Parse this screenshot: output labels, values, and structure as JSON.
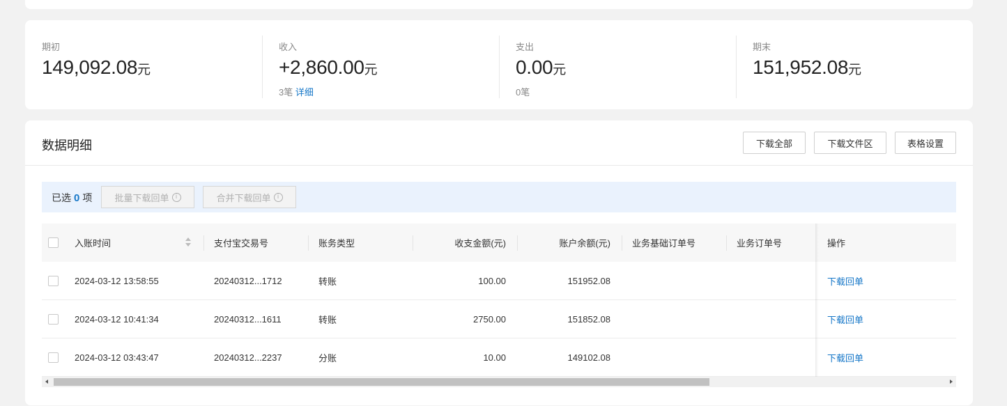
{
  "summary": {
    "items": [
      {
        "label": "期初",
        "amount": "149,092.08",
        "unit": "元"
      },
      {
        "label": "收入",
        "amount": "+2,860.00",
        "unit": "元",
        "count": "3笔",
        "link": "详细"
      },
      {
        "label": "支出",
        "amount": "0.00",
        "unit": "元",
        "count": "0笔"
      },
      {
        "label": "期末",
        "amount": "151,952.08",
        "unit": "元"
      }
    ]
  },
  "detail": {
    "title": "数据明细",
    "buttons": {
      "download_all": "下载全部",
      "download_area": "下载文件区",
      "table_settings": "表格设置"
    },
    "selection": {
      "prefix": "已选",
      "count": "0",
      "suffix": "项",
      "batch_download": "批量下载回单",
      "merge_download": "合并下载回单"
    },
    "columns": [
      "入账时间",
      "支付宝交易号",
      "账务类型",
      "收支金额(元)",
      "账户余额(元)",
      "业务基础订单号",
      "业务订单号",
      "操作"
    ],
    "rows": [
      {
        "time": "2024-03-12 13:58:55",
        "trade_no": "20240312...1712",
        "type": "转账",
        "amount": "100.00",
        "balance": "151952.08",
        "base_order": "",
        "order": "",
        "action": "下载回单"
      },
      {
        "time": "2024-03-12 10:41:34",
        "trade_no": "20240312...1611",
        "type": "转账",
        "amount": "2750.00",
        "balance": "151852.08",
        "base_order": "",
        "order": "",
        "action": "下载回单"
      },
      {
        "time": "2024-03-12 03:43:47",
        "trade_no": "20240312...2237",
        "type": "分账",
        "amount": "10.00",
        "balance": "149102.08",
        "base_order": "",
        "order": "",
        "action": "下载回单"
      }
    ]
  },
  "colors": {
    "accent": "#1677c8",
    "selection_bg": "#eaf2fd",
    "page_bg": "#f2f2f2"
  },
  "icons": {
    "info": "info-circle-icon",
    "sort": "sort-icon",
    "scroll_left": "arrow-left-icon",
    "scroll_right": "arrow-right-icon"
  }
}
